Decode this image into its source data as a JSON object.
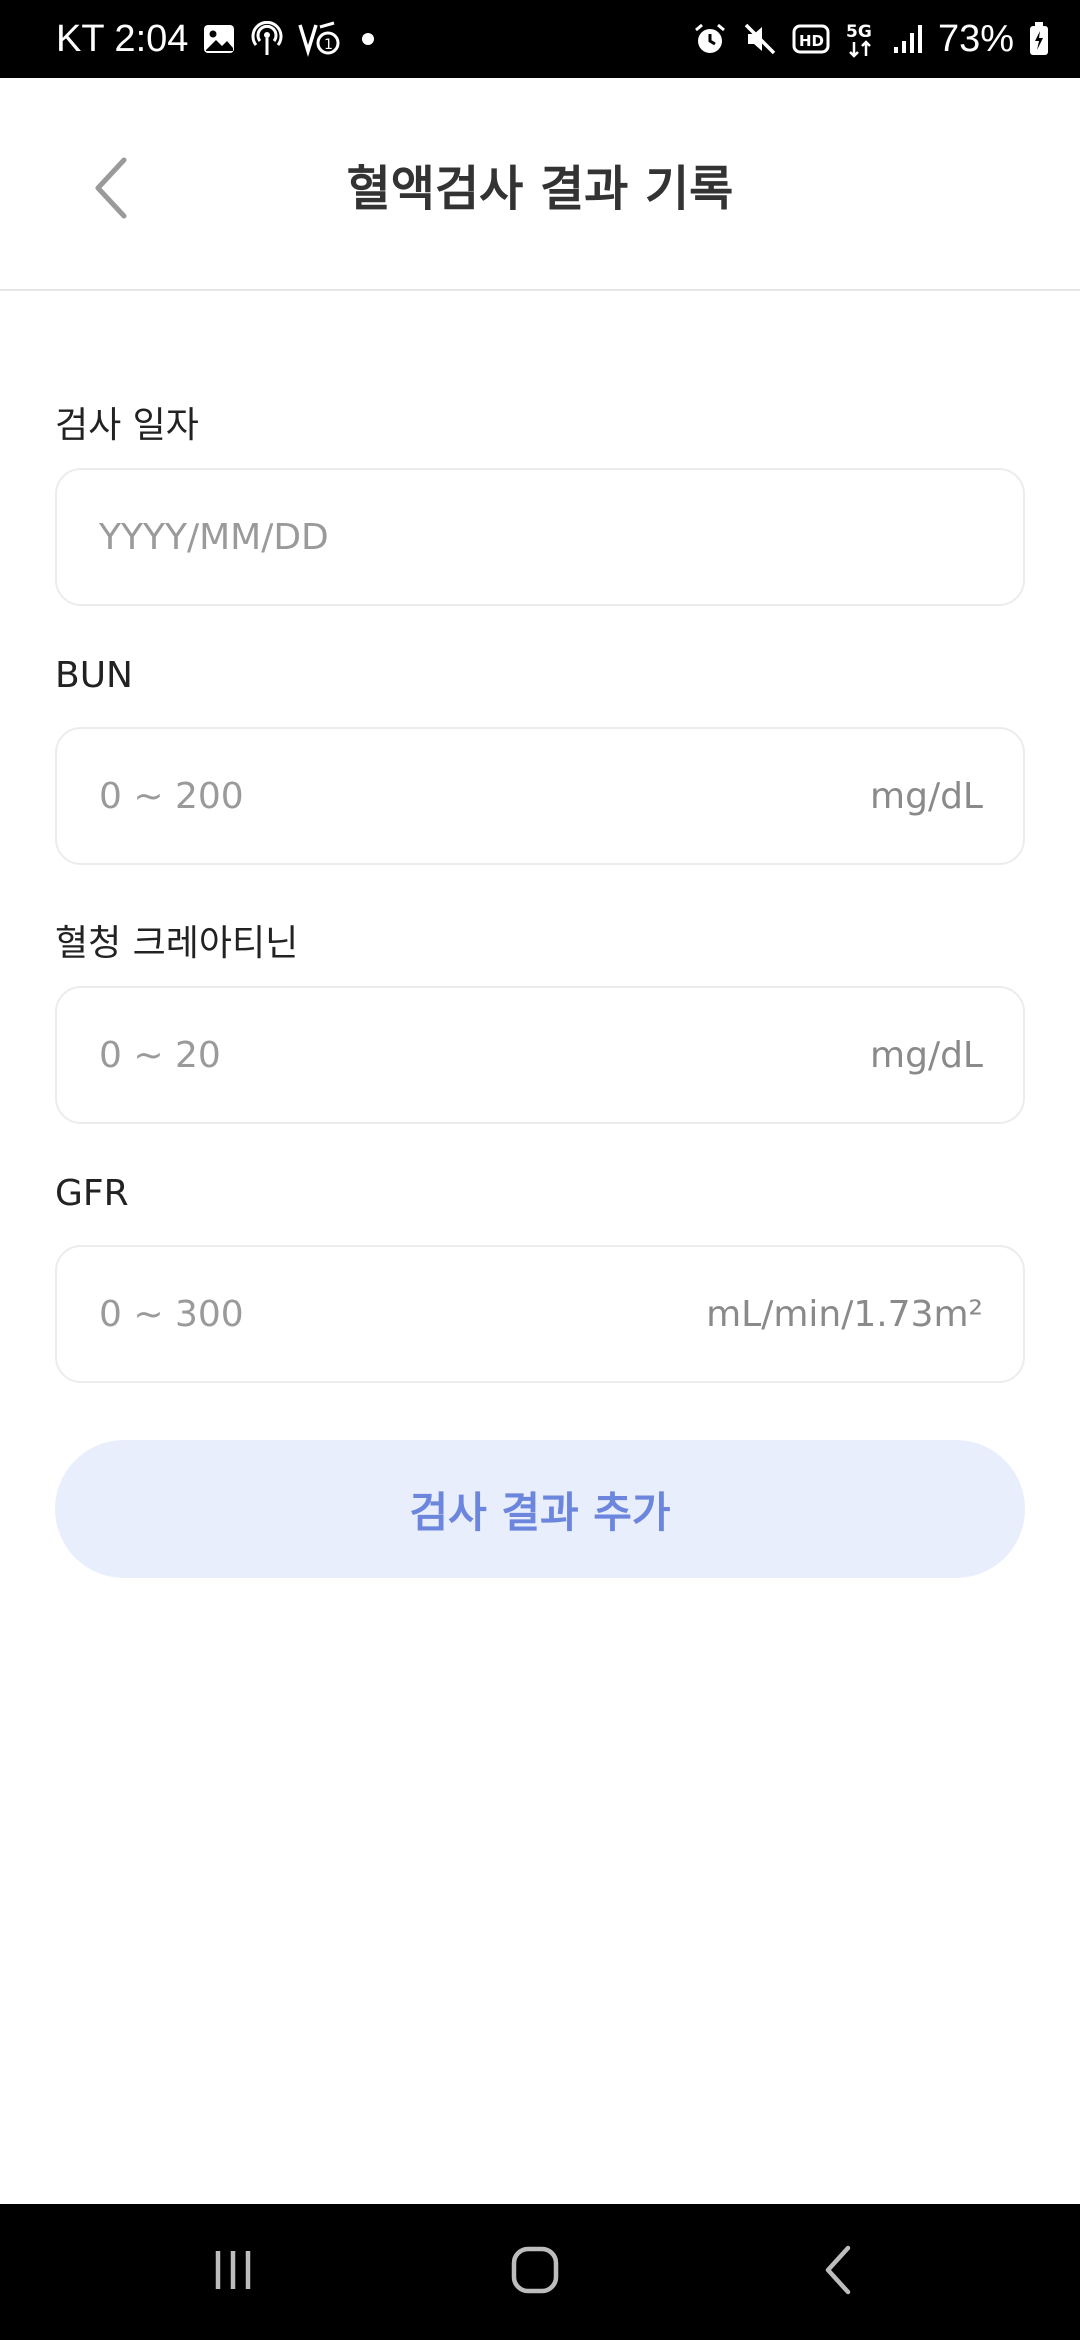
{
  "status_bar": {
    "carrier_time": "KT 2:04",
    "battery": "73%",
    "icons": [
      "gallery-icon",
      "hotspot-icon",
      "volte-icon",
      "dot-icon",
      "alarm-icon",
      "mute-icon",
      "hd-icon",
      "5g-icon",
      "signal-icon",
      "battery-icon"
    ]
  },
  "header": {
    "title": "혈액검사 결과 기록",
    "back_icon": "chevron-left-icon"
  },
  "form": {
    "date": {
      "label": "검사 일자",
      "placeholder": "YYYY/MM/DD",
      "value": ""
    },
    "bun": {
      "label": "BUN",
      "placeholder": "0 ~ 200",
      "unit": "mg/dL",
      "value": ""
    },
    "creatinine": {
      "label": "혈청 크레아티닌",
      "placeholder": "0 ~ 20",
      "unit": "mg/dL",
      "value": ""
    },
    "gfr": {
      "label": "GFR",
      "placeholder": "0 ~ 300",
      "unit": "mL/min/1.73m²",
      "value": ""
    },
    "submit_label": "검사 결과 추가"
  },
  "colors": {
    "button_bg": "#e8eefc",
    "button_text": "#6d86dd"
  },
  "nav_bar": {
    "icons": [
      "recents-icon",
      "home-icon",
      "back-icon"
    ]
  }
}
